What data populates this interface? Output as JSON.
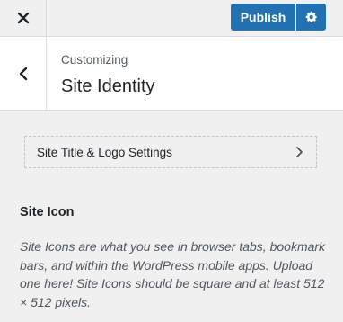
{
  "topbar": {
    "close_icon": "close-icon",
    "publish_label": "Publish",
    "settings_icon": "gear-icon",
    "accent_color": "#2271b1"
  },
  "header": {
    "back_icon": "chevron-left-icon",
    "breadcrumb": "Customizing",
    "title": "Site Identity"
  },
  "sub_section": {
    "label": "Site Title & Logo Settings",
    "icon": "chevron-right-icon"
  },
  "site_icon": {
    "title": "Site Icon",
    "description": "Site Icons are what you see in browser tabs, bookmark bars, and within the WordPress mobile apps. Upload one here! Site Icons should be square and at least 512 × 512 pixels."
  }
}
